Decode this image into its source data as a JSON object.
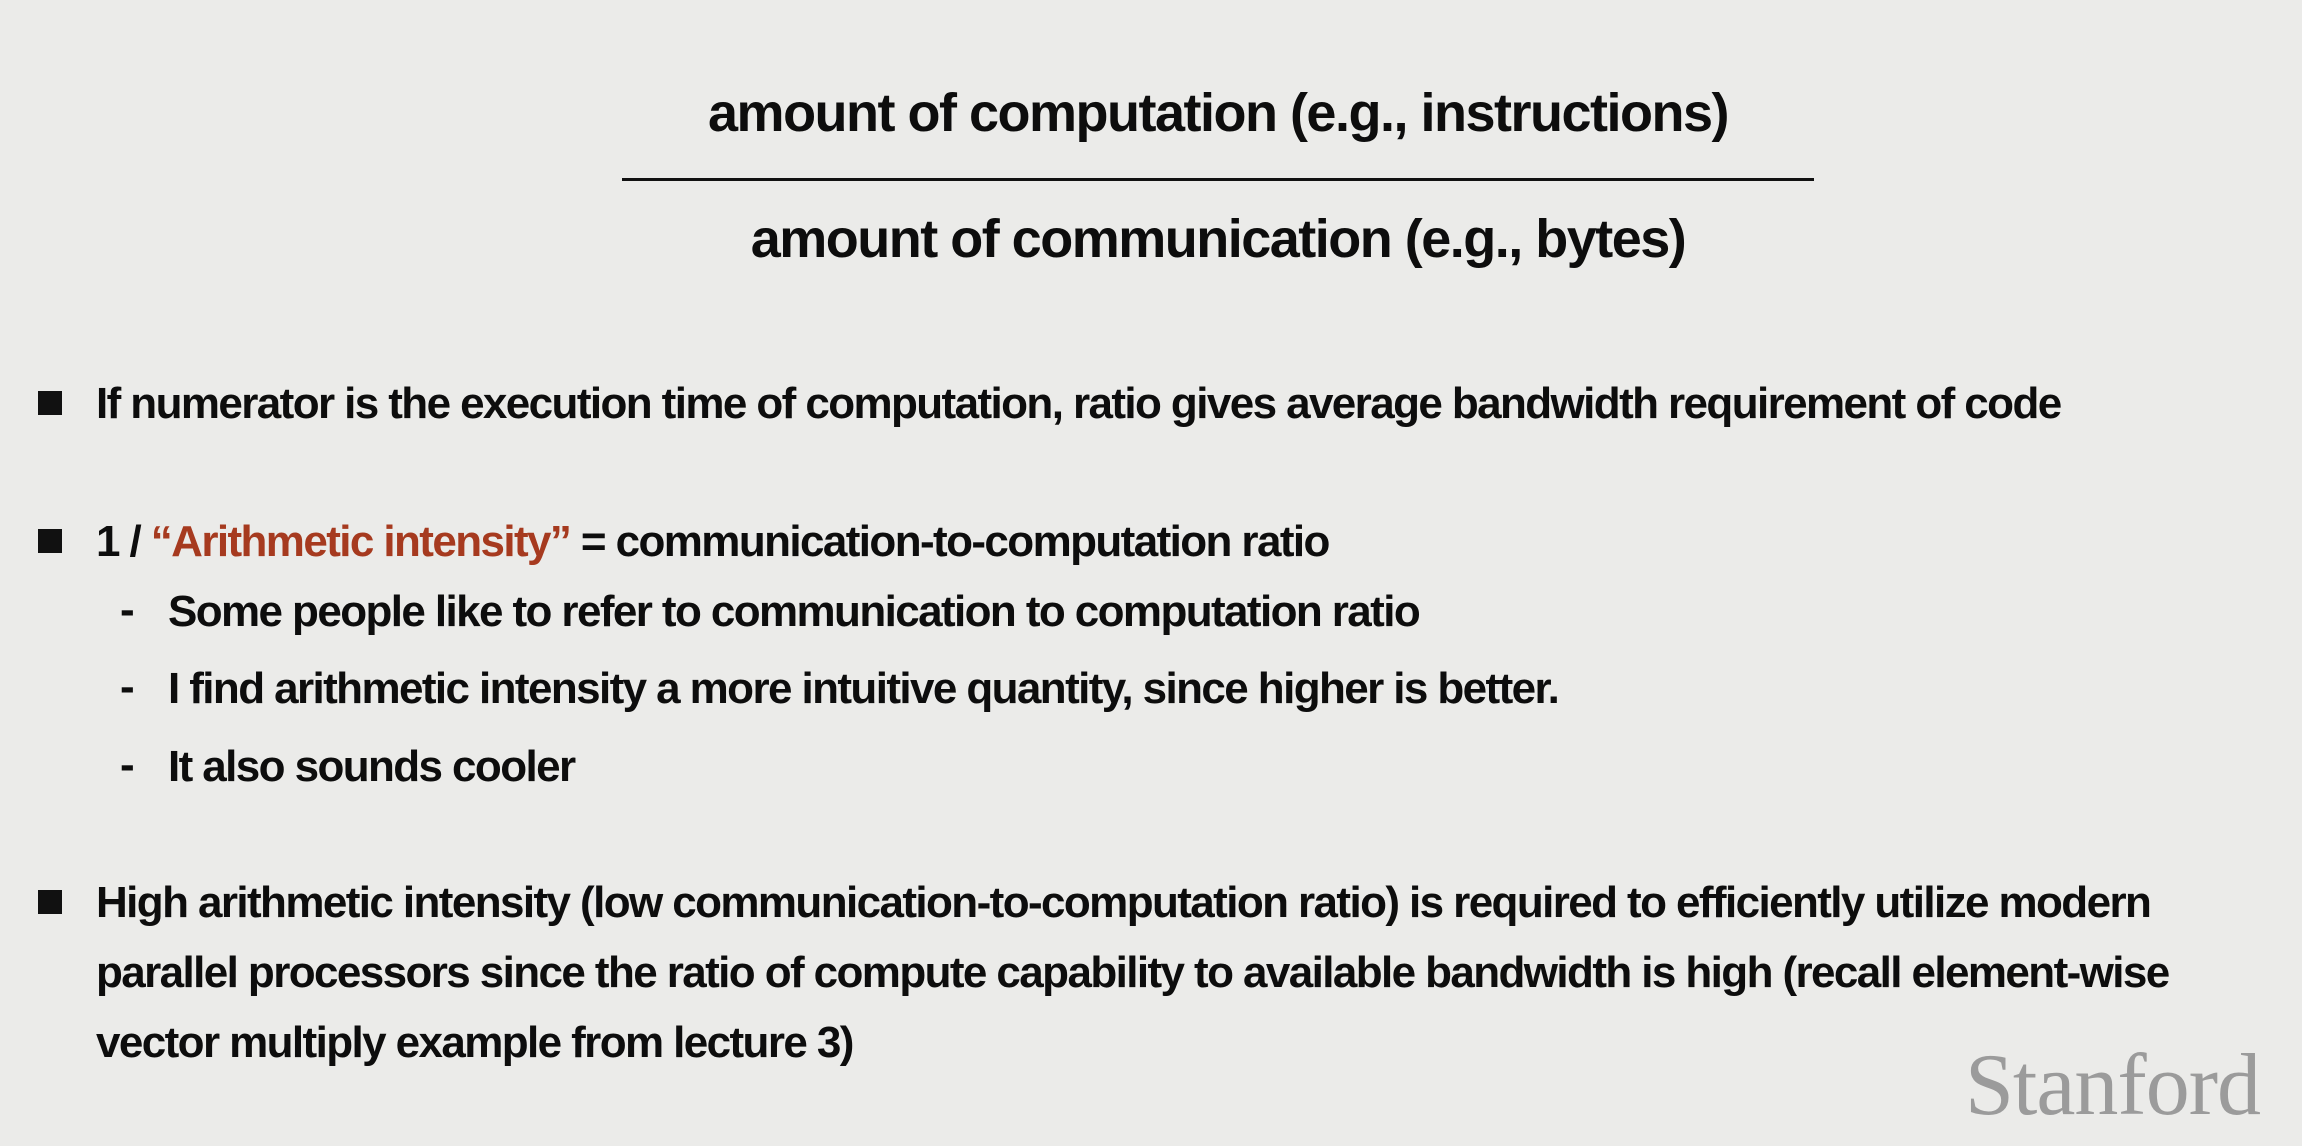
{
  "fraction": {
    "numerator": "amount of computation (e.g., instructions)",
    "denominator": "amount of communication (e.g., bytes)"
  },
  "bullets": [
    {
      "lines": [
        "If numerator is the execution time of computation, ratio gives average bandwidth requirement of code"
      ]
    },
    {
      "prefix": "1 / ",
      "highlight": "“Arithmetic intensity”",
      "suffix": " = communication-to-computation ratio",
      "sub_items": [
        "Some people like to refer to communication to computation ratio",
        "I find arithmetic intensity a more intuitive quantity, since higher is better.",
        "It also sounds cooler"
      ]
    },
    {
      "lines": [
        "High arithmetic intensity (low communication-to-computation ratio) is required to efficiently utilize modern",
        "parallel processors since the ratio of compute capability to available bandwidth is high (recall element-wise",
        "vector multiply example from lecture 3)"
      ]
    }
  ],
  "dash_glyph": "-",
  "logo": "Stanford",
  "colors": {
    "background": "#ebebe9",
    "text": "#0d0d0d",
    "highlight": "#a63a1f",
    "logo": "#9b9b9b"
  }
}
